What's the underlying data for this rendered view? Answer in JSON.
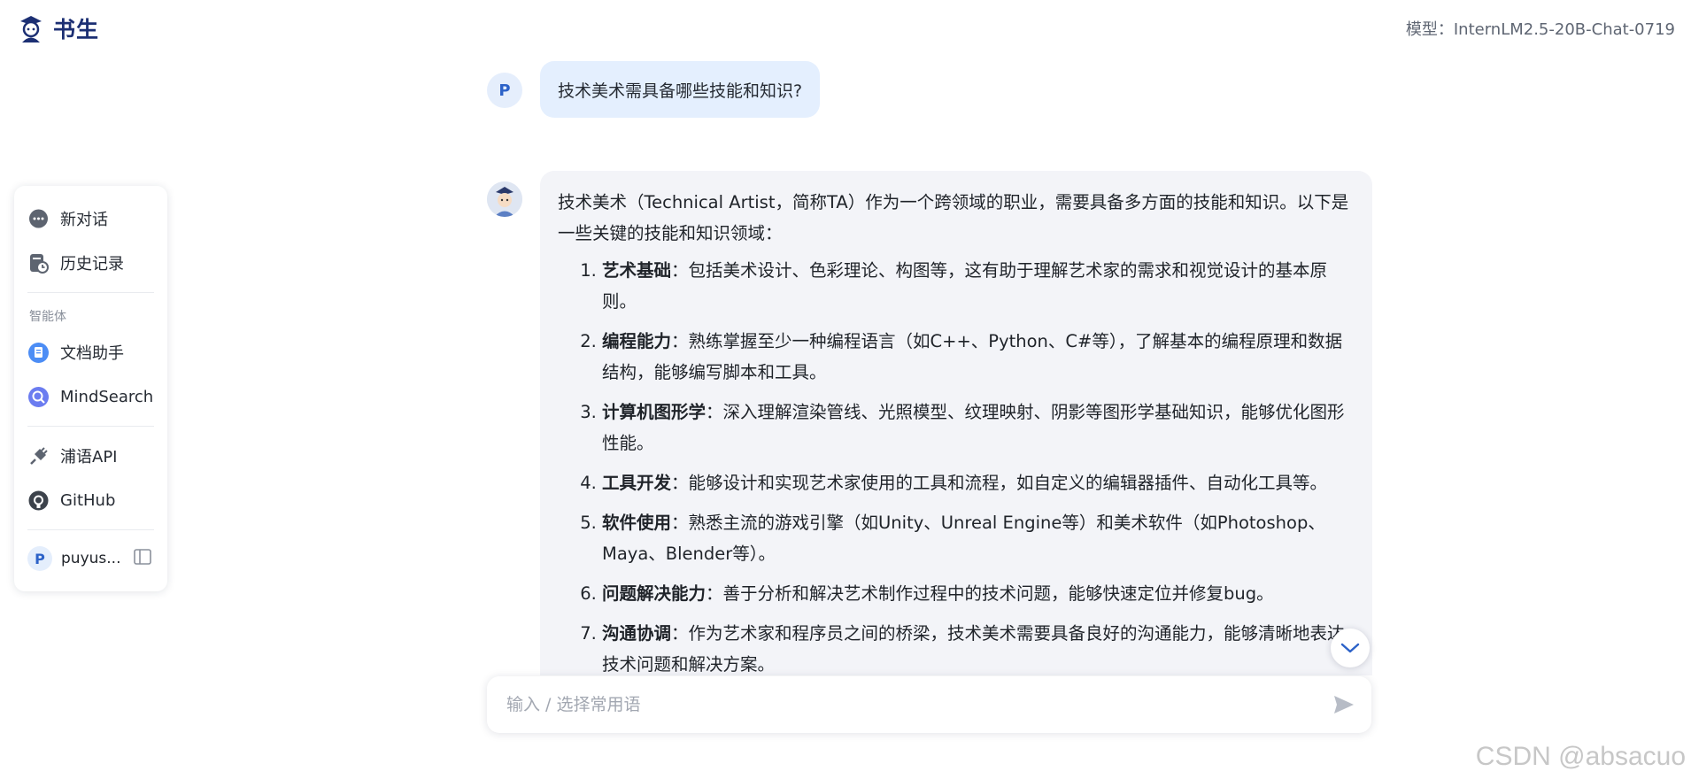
{
  "app": {
    "logo_text": "书生",
    "model_label": "模型：InternLM2.5-20B-Chat-0719"
  },
  "sidebar": {
    "new_chat": "新对话",
    "history": "历史记录",
    "section_agents": "智能体",
    "doc_assistant": "文档助手",
    "mindsearch": "MindSearch",
    "api": "浦语API",
    "github": "GitHub",
    "user_initial": "P",
    "user_name": "puyus..."
  },
  "conversation": {
    "user_initial": "P",
    "user_message": "技术美术需具备哪些技能和知识?",
    "bot_intro": "技术美术（Technical Artist，简称TA）作为一个跨领域的职业，需要具备多方面的技能和知识。以下是一些关键的技能和知识领域：",
    "bot_items": [
      {
        "title": "艺术基础",
        "text": "：包括美术设计、色彩理论、构图等，这有助于理解艺术家的需求和视觉设计的基本原则。"
      },
      {
        "title": "编程能力",
        "text": "：熟练掌握至少一种编程语言（如C++、Python、C#等），了解基本的编程原理和数据结构，能够编写脚本和工具。"
      },
      {
        "title": "计算机图形学",
        "text": "：深入理解渲染管线、光照模型、纹理映射、阴影等图形学基础知识，能够优化图形性能。"
      },
      {
        "title": "工具开发",
        "text": "：能够设计和实现艺术家使用的工具和流程，如自定义的编辑器插件、自动化工具等。"
      },
      {
        "title": "软件使用",
        "text": "：熟悉主流的游戏引擎（如Unity、Unreal Engine等）和美术软件（如Photoshop、Maya、Blender等）。"
      },
      {
        "title": "问题解决能力",
        "text": "：善于分析和解决艺术制作过程中的技术问题，能够快速定位并修复bug。"
      },
      {
        "title": "沟通协调",
        "text": "：作为艺术家和程序员之间的桥梁，技术美术需要具备良好的沟通能力，能够清晰地表达技术问题和解决方案。"
      }
    ]
  },
  "composer": {
    "placeholder": "输入 / 选择常用语"
  },
  "watermark": "CSDN @absacuo",
  "colors": {
    "brand": "#1c2f73",
    "user_bubble": "#e4effe",
    "bot_bubble": "#f3f4f8",
    "accent": "#2c62c8"
  }
}
